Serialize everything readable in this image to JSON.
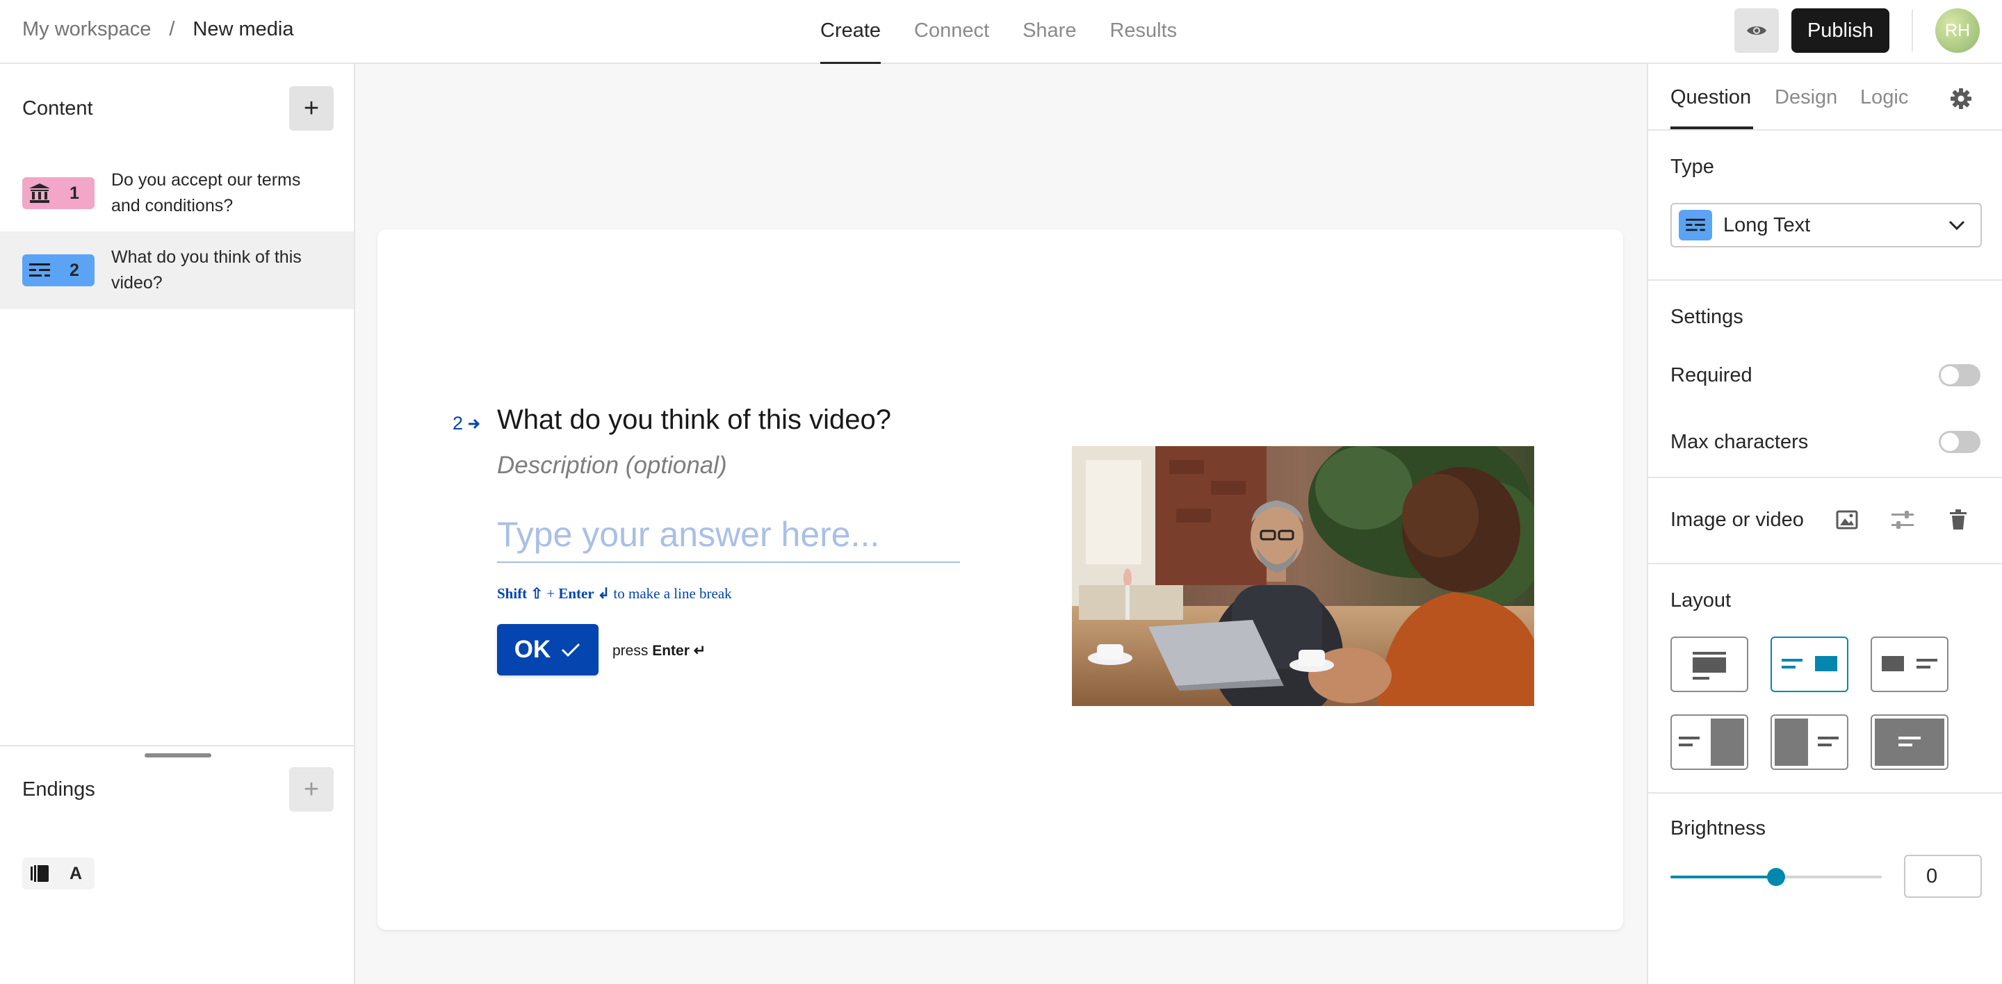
{
  "header": {
    "breadcrumb": [
      "My workspace",
      "/",
      "New media"
    ],
    "tabs": [
      "Create",
      "Connect",
      "Share",
      "Results"
    ],
    "active_tab": "Create",
    "publish_label": "Publish",
    "avatar_initials": "RH"
  },
  "sidebar": {
    "content_title": "Content",
    "questions": [
      {
        "number": "1",
        "text": "Do you accept our terms and conditions?",
        "icon": "bank-icon",
        "color": "#f2a7c9"
      },
      {
        "number": "2",
        "text": "What do you think of this video?",
        "icon": "long-text-icon",
        "color": "#5ba4f5"
      }
    ],
    "endings_title": "Endings",
    "ending": {
      "label": "A",
      "icon": "ending-icon"
    }
  },
  "canvas": {
    "question_number": "2",
    "question_title": "What do you think of this video?",
    "description_placeholder": "Description (optional)",
    "answer_placeholder": "Type your answer here...",
    "hint": {
      "shift": "Shift ⇧",
      "plus": "+",
      "enter": "Enter ↲",
      "rest": "to make a line break"
    },
    "ok_label": "OK",
    "press_label": "press",
    "press_key": "Enter ↵",
    "accent_color": "#0445af"
  },
  "panel": {
    "tabs": [
      "Question",
      "Design",
      "Logic"
    ],
    "active_tab": "Question",
    "type_label": "Type",
    "type_value": "Long Text",
    "settings_label": "Settings",
    "required_label": "Required",
    "max_chars_label": "Max characters",
    "image_video_label": "Image or video",
    "layout_label": "Layout",
    "brightness_label": "Brightness",
    "brightness_value": "0",
    "brightness_slider": 0.5,
    "accent_color": "#0487af"
  }
}
